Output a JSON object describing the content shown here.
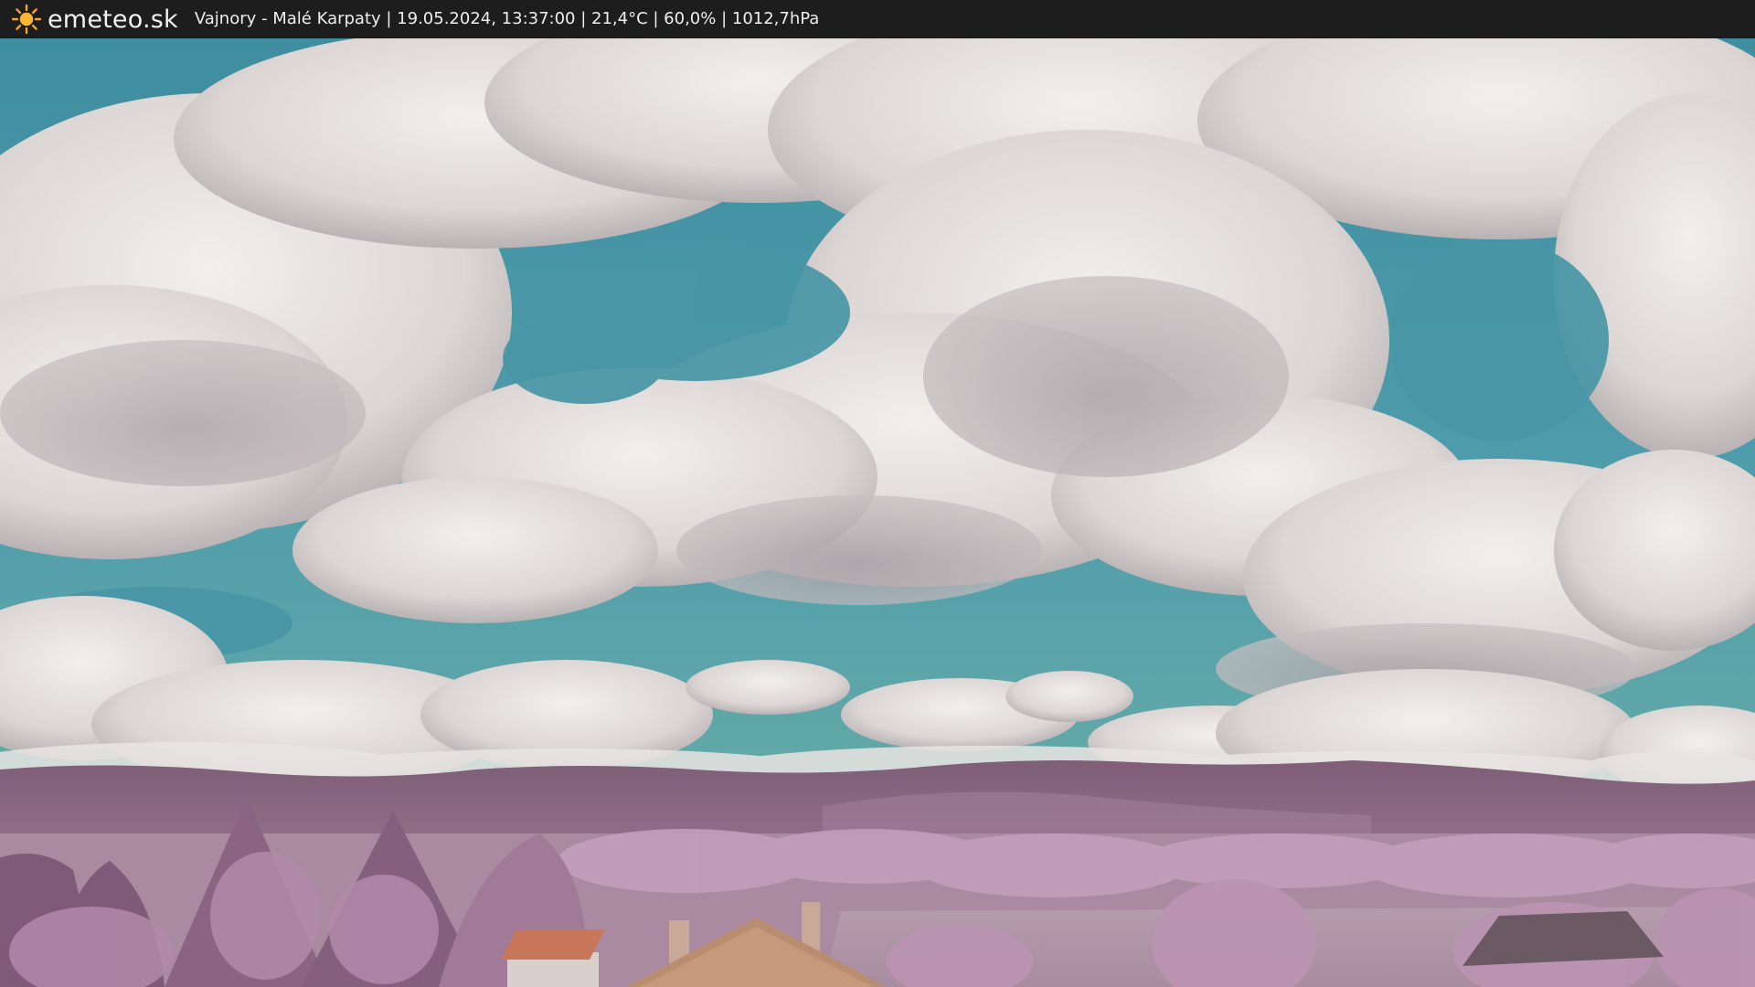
{
  "header": {
    "brand": "emeteo.sk",
    "caption": "Vajnory - Malé Karpaty | 19.05.2024, 13:37:00 | 21,4°C | 60,0% | 1012,7hPa",
    "logo_icon": "sun-icon",
    "logo_color": "#f5a623"
  },
  "scene": {
    "description_icon": "webcam-image",
    "sky_color": "#4a9aa8",
    "cloud_color": "#e6e2e0",
    "hills_color": "#8a6780",
    "foliage_color": "#b98fb0",
    "roof_color": "#c9775a"
  }
}
